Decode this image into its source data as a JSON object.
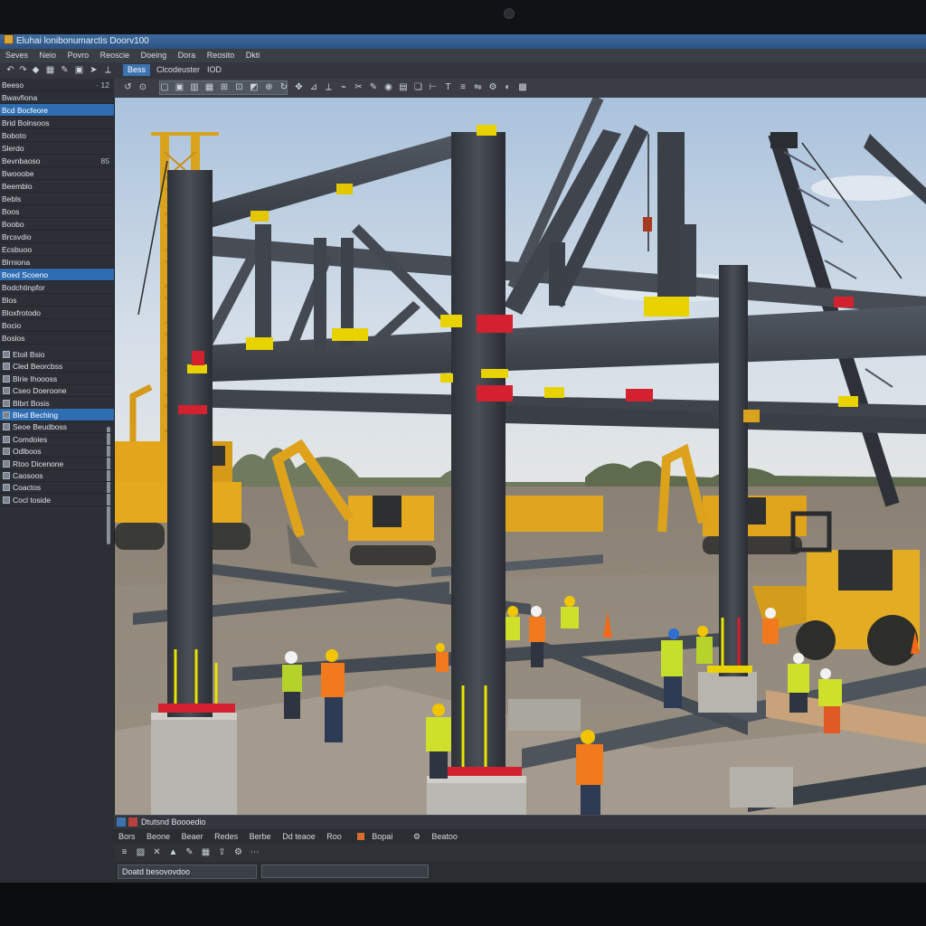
{
  "window": {
    "title": "Eluhai lonibonumarctis Doorv100"
  },
  "menu": [
    "Seves",
    "Neio",
    "Povro",
    "Reoscie",
    "Doeing",
    "Dora",
    "Reosito",
    "Dkti"
  ],
  "toolbar1": {
    "icons": [
      "undo-icon",
      "redo-icon",
      "layer-icon",
      "select-icon",
      "pen-icon",
      "copy-icon",
      "cursor-icon",
      "measure-icon",
      "star-icon"
    ],
    "tabs": [
      "Bess",
      "Clcodeuster",
      "IOD"
    ],
    "active_tab": "Bess"
  },
  "sidebar": {
    "items": [
      {
        "label": "Beeso",
        "value": "· 12"
      },
      {
        "label": "Bwavfiona",
        "value": ""
      },
      {
        "label": "Bcd Bocfeore",
        "value": "",
        "selected": true
      },
      {
        "label": "Brid Bolnsoos",
        "value": ""
      },
      {
        "label": "Boboto",
        "value": ""
      },
      {
        "label": "Slerdo",
        "value": ""
      },
      {
        "label": "Bevnbaoso",
        "value": "85"
      },
      {
        "label": "Bwooobe",
        "value": ""
      },
      {
        "label": "Beemblo",
        "value": ""
      },
      {
        "label": "Bebls",
        "value": ""
      },
      {
        "label": "Boos",
        "value": ""
      },
      {
        "label": "Boobo",
        "value": ""
      },
      {
        "label": "Brcsvdio",
        "value": ""
      },
      {
        "label": "Ecsbuoo",
        "value": ""
      },
      {
        "label": "Blrniona",
        "value": ""
      },
      {
        "label": "Boed Scoeno",
        "value": "",
        "selected": true
      },
      {
        "label": "Bodchtinpfor",
        "value": ""
      },
      {
        "label": "Blos",
        "value": ""
      },
      {
        "label": "Bloxfrotodo",
        "value": ""
      },
      {
        "label": "Bocio",
        "value": ""
      },
      {
        "label": "Boslos",
        "value": ""
      }
    ],
    "subitems": [
      {
        "label": "Etoil Bsio",
        "selected": false
      },
      {
        "label": "Cled Beorcbss",
        "selected": false
      },
      {
        "label": "Blrie Ihoooss",
        "selected": false
      },
      {
        "label": "Cseo Doeroone",
        "selected": false
      },
      {
        "label": "Blbrt Bosis",
        "selected": false
      },
      {
        "label": "Bled Beching",
        "selected": true
      },
      {
        "label": "Seoe Beudboss",
        "selected": false
      },
      {
        "label": "Comdoies",
        "selected": false
      },
      {
        "label": "Odlboos",
        "selected": false
      },
      {
        "label": "Rtoo Dicenone",
        "selected": false
      },
      {
        "label": "Caosoos",
        "selected": false
      },
      {
        "label": "Coactos",
        "selected": false
      },
      {
        "label": "Cocl toside",
        "selected": false
      }
    ]
  },
  "toolbar2": {
    "icons": [
      "undo-icon",
      "redo-icon",
      "box-icon",
      "frame-icon",
      "beam-icon",
      "column-icon",
      "brace-icon",
      "grid-icon",
      "layer-icon",
      "zoom-icon",
      "rotate-icon",
      "pan-icon",
      "snap-icon",
      "measure-icon",
      "link-icon",
      "cut-icon",
      "pencil-icon",
      "node-icon",
      "section-icon",
      "copy-icon",
      "dimension-icon",
      "text-icon",
      "align-icon",
      "mirror-icon",
      "settings-icon",
      "view-icon",
      "render-icon"
    ]
  },
  "bottom_panel": {
    "title": "Dtutsnd Boooedio",
    "tabs": [
      "Bors",
      "Beone",
      "Beaer",
      "Redes",
      "Berbe",
      "Dd teaoe",
      "Roo",
      "Bopai",
      "Beatoo"
    ],
    "icons": [
      "list-icon",
      "check-icon",
      "close-icon",
      "warning-icon",
      "edit-icon",
      "grid-icon",
      "export-icon",
      "settings-icon",
      "more-icon"
    ],
    "status_text": "Doatd besovovdoo",
    "progress": 0.0
  },
  "colors": {
    "accent": "#2f6db2",
    "steel": "#3e434b",
    "sky": "#c9d5e2",
    "safety_yellow": "#e8d200",
    "anchor_red": "#d3212f"
  }
}
